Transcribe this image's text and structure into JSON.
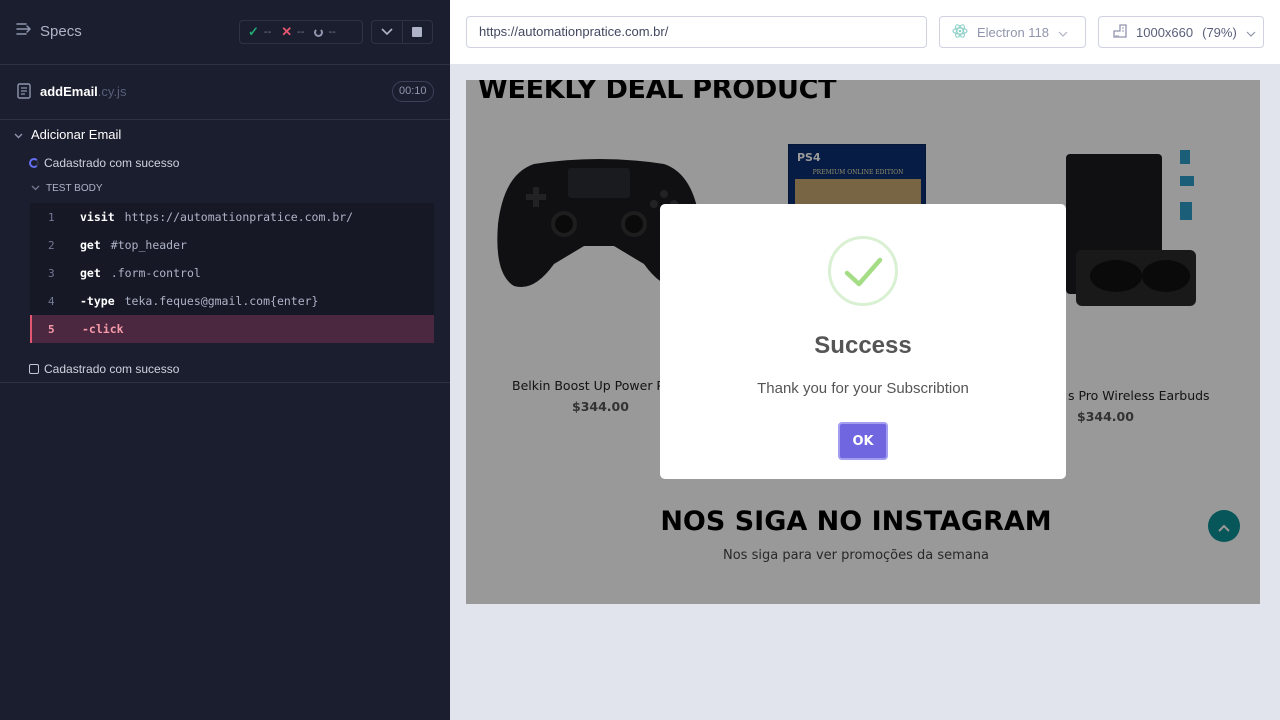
{
  "reporter": {
    "specs_label": "Specs",
    "stats": {
      "passed": "--",
      "failed": "--",
      "pending": "--"
    },
    "file": {
      "name": "addEmail",
      "ext": ".cy.js",
      "timer": "00:10"
    },
    "suite": {
      "title": "Adicionar Email"
    },
    "tests": [
      {
        "title": "Cadastrado com sucesso",
        "state": "running"
      },
      {
        "title": "Cadastrado com sucesso",
        "state": "pending"
      }
    ],
    "test_body_label": "TEST BODY",
    "commands": [
      {
        "num": "1",
        "name": "visit",
        "message": "https://automationpratice.com.br/"
      },
      {
        "num": "2",
        "name": "get",
        "message": "#top_header"
      },
      {
        "num": "3",
        "name": "get",
        "message": ".form-control"
      },
      {
        "num": "4",
        "name": "-type",
        "message": "teka.feques@gmail.com{enter}"
      },
      {
        "num": "5",
        "name": "-click",
        "message": "",
        "state": "failed"
      }
    ]
  },
  "browser": {
    "url": "https://automationpratice.com.br/",
    "browser_name": "Electron 118",
    "viewport": "1000x660",
    "scale": "(79%)"
  },
  "aut": {
    "section_title": "WEEKLY DEAL PRODUCT",
    "products": [
      {
        "name": "Belkin Boost Up Power P",
        "price": "$344.00"
      },
      {
        "name": "s Pro Wireless Earbuds",
        "price": "$344.00"
      }
    ],
    "ps4_label": "PS4",
    "ps4_edition": "PREMIUM ONLINE EDITION",
    "instagram_title": "NOS SIGA NO INSTAGRAM",
    "instagram_sub": "Nos siga para ver promoções da semana",
    "modal": {
      "title": "Success",
      "text": "Thank you for your Subscribtion",
      "ok_label": "OK"
    }
  },
  "colors": {
    "reporter_bg": "#1b1e2e",
    "pass": "#1fa971",
    "fail": "#e45770",
    "running": "#6470f3",
    "ok_button": "#7066e0",
    "success_check": "#a5dc86",
    "scroll_top": "#0a8f97"
  }
}
